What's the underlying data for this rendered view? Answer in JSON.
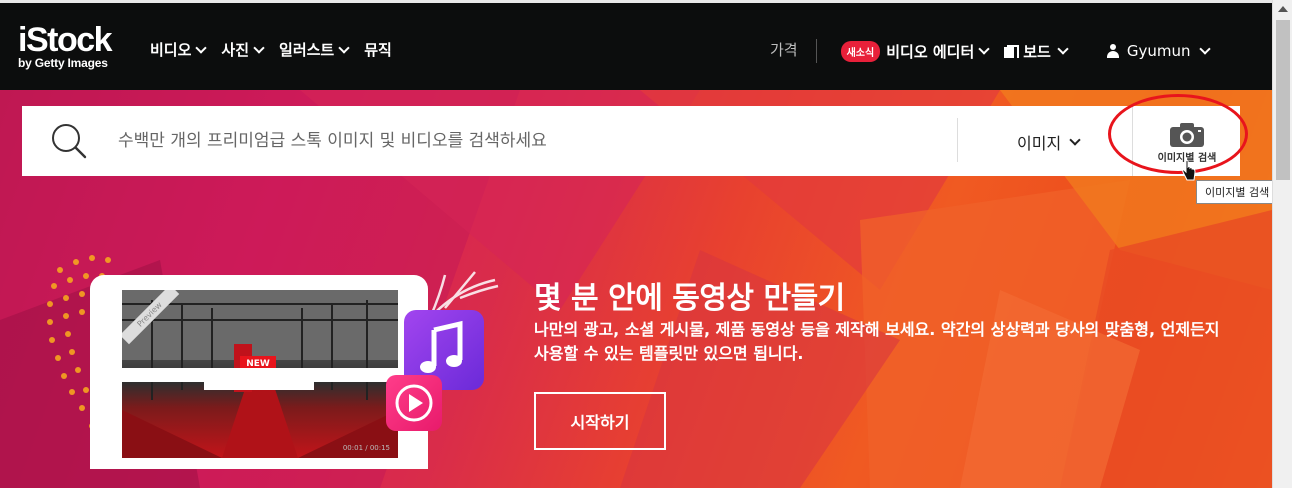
{
  "header": {
    "logo_main": "iStock",
    "logo_sub": "by Getty Images",
    "nav": [
      {
        "label": "비디오",
        "dropdown": true
      },
      {
        "label": "사진",
        "dropdown": true
      },
      {
        "label": "일러스트",
        "dropdown": true
      },
      {
        "label": "뮤직",
        "dropdown": false
      }
    ],
    "price_label": "가격",
    "new_badge": "새소식",
    "video_editor_label": "비디오 에디터",
    "board_label": "보드",
    "user_name": "Gyumun"
  },
  "search": {
    "placeholder": "수백만 개의 프리미엄급 스톡 이미지 및 비디오를 검색하세요",
    "type_selected": "이미지",
    "image_search_label": "이미지별 검색",
    "tooltip": "이미지별 검색"
  },
  "hero": {
    "title": "몇 분 안에 동영상 만들기",
    "description": "나만의 광고, 소셜 게시물, 제품 동영상 등을 제작해 보세요. 약간의 상상력과 당사의 맞춤형, 언제든지 사용할 수 있는 템플릿만 있으면 됩니다.",
    "cta_label": "시작하기",
    "preview_tag": "Preview",
    "new_label": "NEW",
    "timecode": "00:01 / 00:15"
  },
  "colors": {
    "topbar_bg": "#0c0d0d",
    "badge": "#e8203a",
    "annotation_ring": "#e8141c"
  }
}
